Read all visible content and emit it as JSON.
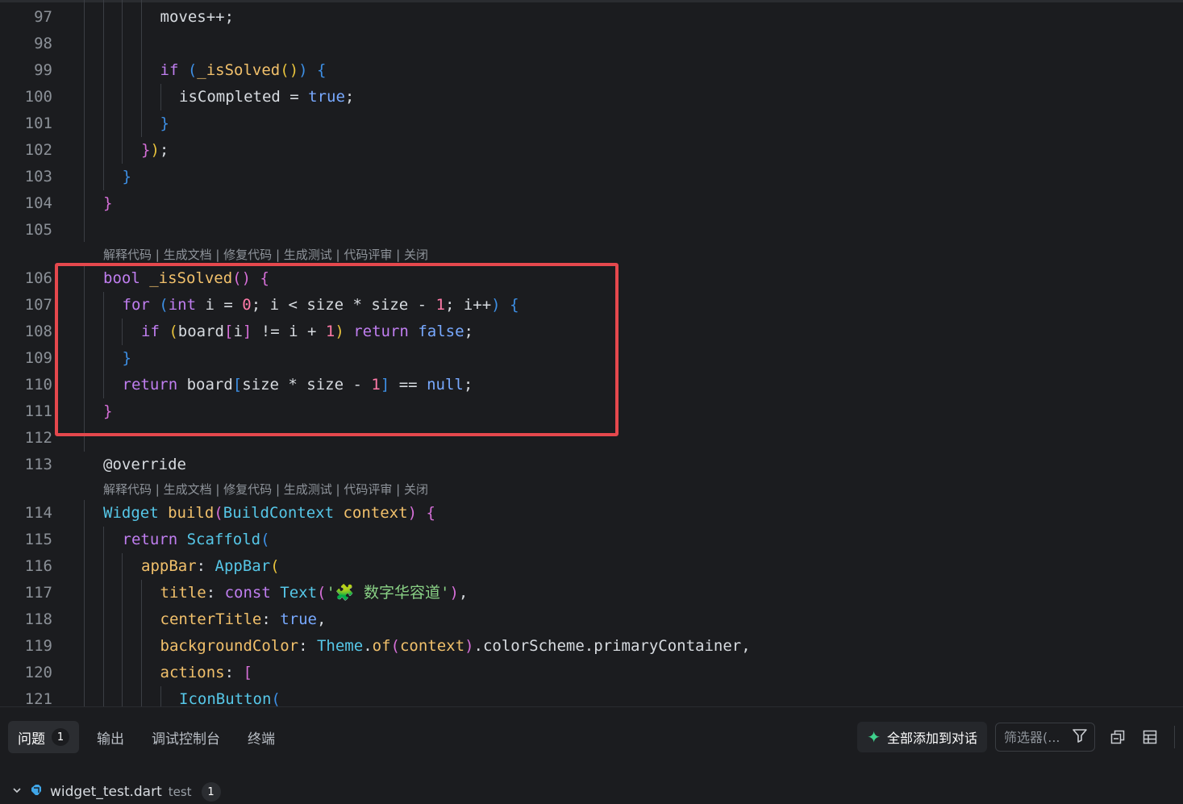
{
  "editor": {
    "lines": [
      {
        "n": "97",
        "html": "<span class=\"t-fn\"></span>moves++;"
      },
      {
        "n": "98",
        "html": ""
      },
      {
        "n": "99",
        "html": "<span class=\"t-kw2\">if</span> <span class=\"b3\">(</span><span class=\"t-fn\">_isSolved</span><span class=\"b1\">()</span><span class=\"b3\">)</span> <span class=\"b3\">{</span>"
      },
      {
        "n": "100",
        "html": "isCompleted = <span class=\"t-kw\">true</span>;"
      },
      {
        "n": "101",
        "html": "<span class=\"b3\">}</span>"
      },
      {
        "n": "102",
        "html": "<span class=\"b2\">}</span><span class=\"b1\">)</span>;"
      },
      {
        "n": "103",
        "html": "<span class=\"b3\">}</span>"
      },
      {
        "n": "104",
        "html": "<span class=\"b2\">}</span>"
      },
      {
        "n": "105",
        "html": ""
      },
      {
        "n": "106",
        "html": "<span class=\"t-kw2\">bool</span> <span class=\"t-fn\">_isSolved</span><span class=\"b2\">()</span> <span class=\"b2\">{</span>"
      },
      {
        "n": "107",
        "html": "<span class=\"t-kw2\">for</span> <span class=\"b3\">(</span><span class=\"t-kw2\">int</span> i = <span class=\"t-num\">0</span>; i &lt; size * size - <span class=\"t-num\">1</span>; i++<span class=\"b3\">)</span> <span class=\"b3\">{</span>"
      },
      {
        "n": "108",
        "html": "<span class=\"t-kw2\">if</span> <span class=\"b1\">(</span>board<span class=\"b2\">[</span>i<span class=\"b2\">]</span> != i + <span class=\"t-num\">1</span><span class=\"b1\">)</span> <span class=\"t-kw2\">return</span> <span class=\"t-kw\">false</span>;"
      },
      {
        "n": "109",
        "html": "<span class=\"b3\">}</span>"
      },
      {
        "n": "110",
        "html": "<span class=\"t-kw2\">return</span> board<span class=\"b3\">[</span>size * size - <span class=\"t-num\">1</span><span class=\"b3\">]</span> == <span class=\"t-kw\">null</span>;"
      },
      {
        "n": "111",
        "html": "<span class=\"b2\">}</span>"
      },
      {
        "n": "112",
        "html": ""
      },
      {
        "n": "113",
        "html": "<span class=\"t-ann\">@override</span>"
      },
      {
        "n": "114",
        "html": "<span class=\"t-ty\">Widget</span> <span class=\"t-fn\">build</span><span class=\"b2\">(</span><span class=\"t-ty\">BuildContext</span> <span class=\"t-fn\">context</span><span class=\"b2\">)</span> <span class=\"b2\">{</span>"
      },
      {
        "n": "115",
        "html": "<span class=\"t-kw2\">return</span> <span class=\"t-ty\">Scaffold</span><span class=\"b3\">(</span>"
      },
      {
        "n": "116",
        "html": "<span class=\"t-prop\">appBar</span>: <span class=\"t-ty\">AppBar</span><span class=\"b1\">(</span>"
      },
      {
        "n": "117",
        "html": "<span class=\"t-prop\">title</span>: <span class=\"t-kw2\">const</span> <span class=\"t-ty\">Text</span><span class=\"b2\">(</span><span class=\"t-str\">'🧩 数字华容道'</span><span class=\"b2\">)</span>,"
      },
      {
        "n": "118",
        "html": "<span class=\"t-prop\">centerTitle</span>: <span class=\"t-kw\">true</span>,"
      },
      {
        "n": "119",
        "html": "<span class=\"t-prop\">backgroundColor</span>: <span class=\"t-ty\">Theme</span>.<span class=\"t-fn\">of</span><span class=\"b2\">(</span><span class=\"t-fn\">context</span><span class=\"b2\">)</span>.colorScheme.primaryContainer,"
      },
      {
        "n": "120",
        "html": "<span class=\"t-prop\">actions</span>: <span class=\"b2\">[</span>"
      },
      {
        "n": "121",
        "html": "<span class=\"t-ty\">IconButton</span><span class=\"b3\">(</span>"
      }
    ],
    "code_lens_label": "解释代码 | 生成文档 | 修复代码 | 生成测试 | 代码评审 | 关闭"
  },
  "panel": {
    "tabs": [
      {
        "label": "问题",
        "badge": "1",
        "active": true
      },
      {
        "label": "输出",
        "active": false
      },
      {
        "label": "调试控制台",
        "active": false
      },
      {
        "label": "终端",
        "active": false
      }
    ],
    "add_all_label": "全部添加到对话",
    "filter_placeholder": "筛选器(...",
    "file_entry": {
      "file_name": "widget_test.dart",
      "folder": "test",
      "count": "1"
    }
  },
  "colors": {
    "background": "#1b1c1f",
    "highlight_box": "#e5484d",
    "accent_sparkle": "#3fd18d"
  }
}
